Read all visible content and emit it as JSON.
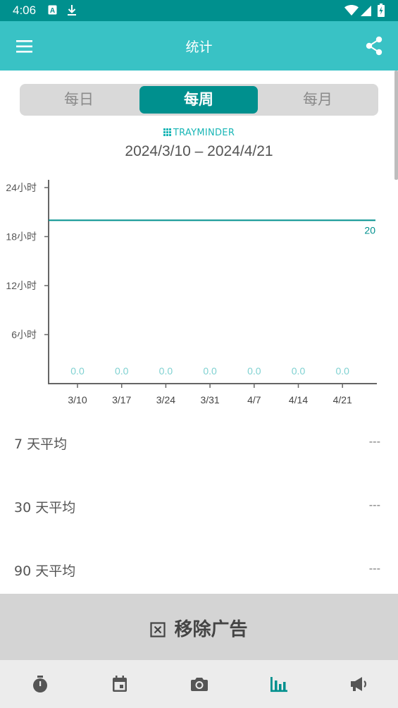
{
  "status_bar": {
    "time": "4:06",
    "icons": [
      "a-badge-icon",
      "download-icon",
      "wifi-icon",
      "signal-icon",
      "battery-charging-icon"
    ]
  },
  "app_bar": {
    "title": "统计",
    "menu_icon": "menu-icon",
    "share_icon": "share-icon"
  },
  "segments": [
    {
      "label": "每日",
      "active": false
    },
    {
      "label": "每周",
      "active": true
    },
    {
      "label": "每月",
      "active": false
    }
  ],
  "brand": "TRAYMINDER",
  "date_range": "2024/3/10 – 2024/4/21",
  "colors": {
    "primary": "#39c2c5",
    "primary_dark": "#00908e",
    "target_line": "#00908e",
    "value_label": "#7fd1d1"
  },
  "chart_data": {
    "type": "bar",
    "categories": [
      "3/10",
      "3/17",
      "3/24",
      "3/31",
      "4/7",
      "4/14",
      "4/21"
    ],
    "values": [
      0.0,
      0.0,
      0.0,
      0.0,
      0.0,
      0.0,
      0.0
    ],
    "value_labels": [
      "0.0",
      "0.0",
      "0.0",
      "0.0",
      "0.0",
      "0.0",
      "0.0"
    ],
    "y_ticks": [
      6,
      12,
      18,
      24
    ],
    "y_tick_labels": [
      "6小时",
      "12小时",
      "18小时",
      "24小时"
    ],
    "ylim": [
      0,
      24
    ],
    "target_line": {
      "value": 20,
      "label": "20"
    },
    "grid": false
  },
  "averages": [
    {
      "label": "7 天平均",
      "value": "---"
    },
    {
      "label": "30 天平均",
      "value": "---"
    },
    {
      "label": "90 天平均",
      "value": "---"
    }
  ],
  "remove_ads": {
    "label": "移除广告",
    "icon": "close-box-icon"
  },
  "bottom_nav": [
    {
      "icon": "timer-icon",
      "active": false
    },
    {
      "icon": "calendar-icon",
      "active": false
    },
    {
      "icon": "camera-icon",
      "active": false
    },
    {
      "icon": "bar-chart-icon",
      "active": true
    },
    {
      "icon": "megaphone-icon",
      "active": false
    }
  ]
}
